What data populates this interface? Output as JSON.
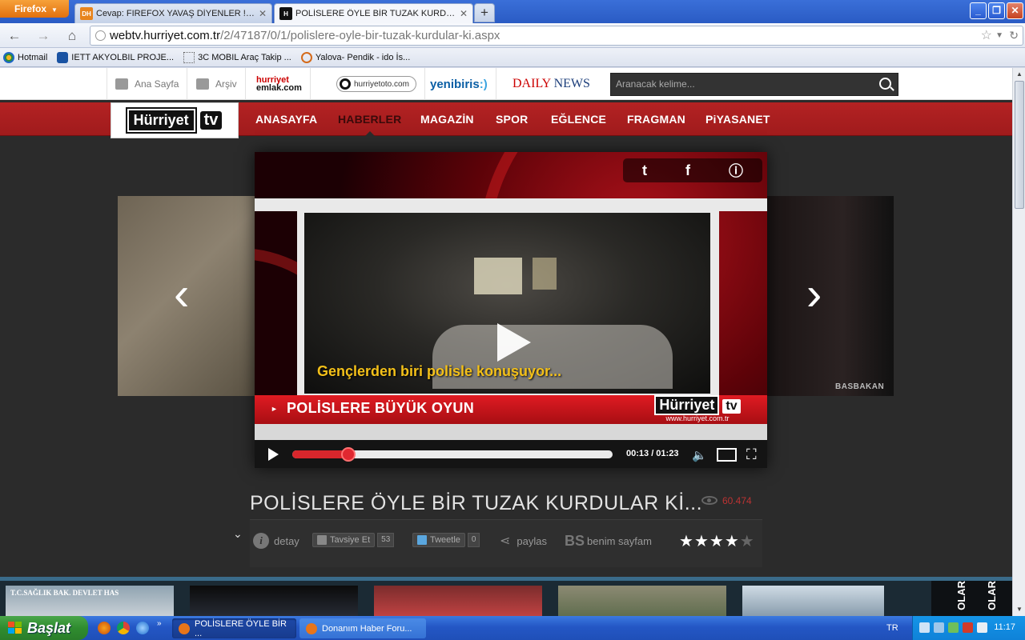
{
  "browser": {
    "menu_button": "Firefox",
    "tabs": [
      {
        "favicon": "DH",
        "title": "Cevap: FIREFOX YAVAŞ DİYENLER !!; RE..."
      },
      {
        "favicon": "H",
        "title": "POLİSLERE ÖYLE BİR TUZAK KURDULAR ..."
      }
    ],
    "url_domain": "webtv.hurriyet.com.tr",
    "url_path": "/2/47187/0/1/polislere-oyle-bir-tuzak-kurdular-ki.aspx",
    "bookmarks": [
      {
        "label": "Hotmail",
        "icon": "msn-butterfly-icon"
      },
      {
        "label": "IETT AKYOLBIL PROJE...",
        "icon": "hp-icon"
      },
      {
        "label": "3C MOBIL Araç Takip ...",
        "icon": "blank-page-icon"
      },
      {
        "label": "Yalova- Pendik - ido İs...",
        "icon": "ido-icon"
      }
    ]
  },
  "site": {
    "top_links": [
      "Ana Sayfa",
      "Arşiv"
    ],
    "partners": {
      "emlak_top": "hurriyet",
      "emlak_bottom": "emlak.com",
      "oto": "hurriyetoto.com",
      "yeni_a": "yenibiris",
      "yeni_b": ":)",
      "daily_a": "DAILY",
      "daily_b": "NEWS"
    },
    "search_placeholder": "Aranacak kelime...",
    "logo_text": "Hürriyet",
    "logo_tv": "tv",
    "menu": [
      "ANASAYFA",
      "HABERLER",
      "MAGAZİN",
      "SPOR",
      "EĞLENCE",
      "FRAGMAN",
      "PiYASANET"
    ],
    "active_menu": "HABERLER"
  },
  "player": {
    "subtitle": "Gençlerden biri polisle konuşuyor...",
    "lower_third": "POLİSLERE BÜYÜK OYUN",
    "watermark_name": "Hürriyet",
    "watermark_tv": "tv",
    "watermark_url": "www.hurriyet.com.tr",
    "side_badge": "BASBAKAN",
    "time": "00:13 / 01:23",
    "progress": 0.176
  },
  "video": {
    "title": "POLİSLERE ÖYLE BİR TUZAK KURDULAR Kİ...",
    "views": "60.474",
    "detail": "detay",
    "like_label": "Tavsiye Et",
    "like_count": "53",
    "tweet_label": "Tweetle",
    "tweet_count": "0",
    "share": "paylas",
    "mypage_icon": "BS",
    "mypage": "benim sayfam",
    "rating": 4,
    "rating_max": 5
  },
  "strip": {
    "side_label": "OLAR",
    "thumb0_text": "T.C.SAĞLIK BAK. DEVLET HAS"
  },
  "taskbar": {
    "start": "Başlat",
    "tasks": [
      "POLİSLERE ÖYLE BİR ...",
      "Donanım Haber Foru..."
    ],
    "lang": "TR",
    "clock": "11:17"
  },
  "colors": {
    "menu_red": "#b32223",
    "page_dark": "#2b2b2b",
    "progress_red": "#d8262c",
    "xp_blue": "#2457c5"
  }
}
